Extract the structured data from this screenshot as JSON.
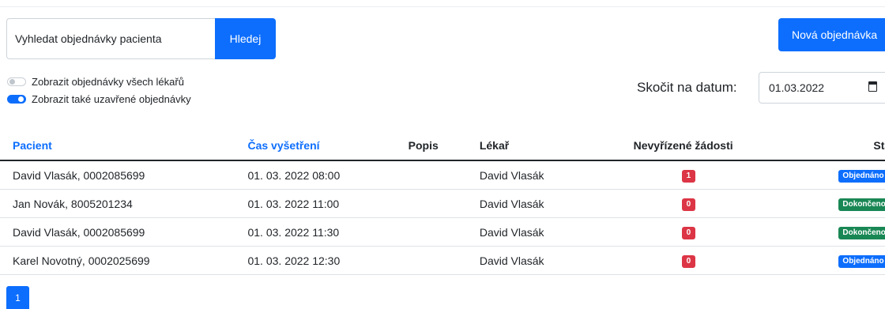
{
  "search": {
    "placeholder": "Vyhledat objednávky pacienta",
    "button_label": "Hledej"
  },
  "new_order_button": "Nová objednávka",
  "toggles": [
    {
      "label": "Zobrazit objednávky všech lékařů",
      "checked": false
    },
    {
      "label": "Zobrazit také uzavřené objednávky",
      "checked": true
    }
  ],
  "date_jump": {
    "label": "Skočit na datum:",
    "value": "01.03.2022"
  },
  "table": {
    "headers": [
      "Pacient",
      "Čas vyšetření",
      "Popis",
      "Lékař",
      "Nevyřízené žádosti",
      "Stav"
    ],
    "rows": [
      {
        "patient": "David Vlasák, 0002085699",
        "time": "01. 03. 2022 08:00",
        "description": "",
        "doctor": "David Vlasák",
        "pending": "1",
        "status": "Objednáno",
        "status_color": "#0d6efd"
      },
      {
        "patient": "Jan Novák, 8005201234",
        "time": "01. 03. 2022 11:00",
        "description": "",
        "doctor": "David Vlasák",
        "pending": "0",
        "status": "Dokončeno",
        "status_color": "#198754"
      },
      {
        "patient": "David Vlasák, 0002085699",
        "time": "01. 03. 2022 11:30",
        "description": "",
        "doctor": "David Vlasák",
        "pending": "0",
        "status": "Dokončeno",
        "status_color": "#198754"
      },
      {
        "patient": "Karel Novotný, 0002025699",
        "time": "01. 03. 2022 12:30",
        "description": "",
        "doctor": "David Vlasák",
        "pending": "0",
        "status": "Objednáno",
        "status_color": "#0d6efd"
      }
    ]
  },
  "pagination": {
    "current_page": "1"
  },
  "colors": {
    "primary": "#0d6efd",
    "danger": "#dc3545",
    "success": "#198754"
  }
}
